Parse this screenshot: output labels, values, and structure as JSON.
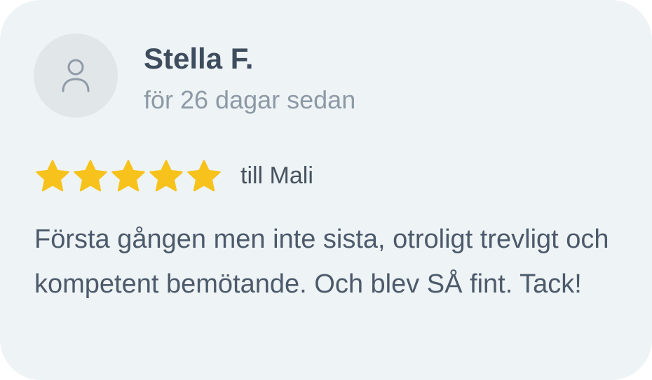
{
  "review": {
    "author_name": "Stella F.",
    "posted_ago": "för 26 dagar sedan",
    "rating": 5,
    "rating_max": 5,
    "recipient": "till Mali",
    "text": "Första gången men inte sista, otroligt trevligt och kompetent bemötande. Och blev SÅ fint. Tack!"
  },
  "icons": {
    "avatar": "user-icon",
    "star": "star-icon"
  },
  "colors": {
    "card_background": "#eef3f5",
    "avatar_background": "#e1e6e9",
    "star": "#f7c21b",
    "name": "#3e4d5e",
    "muted": "#8d9aa6",
    "body_text": "#4c5a6b"
  }
}
